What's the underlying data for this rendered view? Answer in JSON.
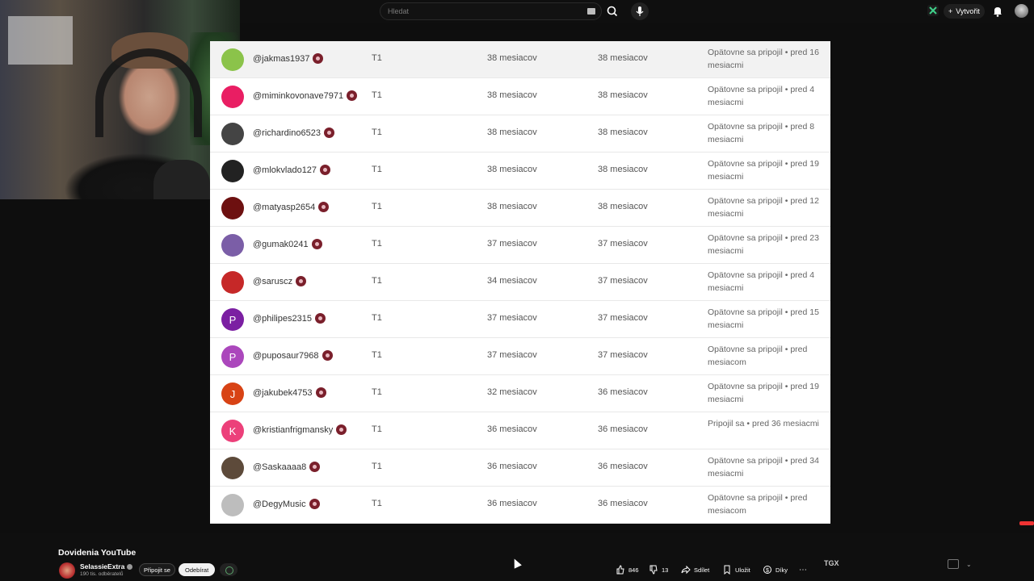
{
  "search": {
    "placeholder": "Hledat"
  },
  "header": {
    "create_label": "Vytvořit"
  },
  "rows": [
    {
      "username": "@jakmas1937",
      "tier": "T1",
      "col1": "38 mesiacov",
      "col2": "38 mesiacov",
      "status": "Opätovne sa pripojil • pred 16 mesiacmi",
      "avatar_letter": "",
      "avatar_color": "#8bc34a"
    },
    {
      "username": "@miminkovonave7971",
      "tier": "T1",
      "col1": "38 mesiacov",
      "col2": "38 mesiacov",
      "status": "Opätovne sa pripojil • pred 4 mesiacmi",
      "avatar_letter": "",
      "avatar_color": "#e91e63"
    },
    {
      "username": "@richardino6523",
      "tier": "T1",
      "col1": "38 mesiacov",
      "col2": "38 mesiacov",
      "status": "Opätovne sa pripojil • pred 8 mesiacmi",
      "avatar_letter": "",
      "avatar_color": "#444444"
    },
    {
      "username": "@mlokvlado127",
      "tier": "T1",
      "col1": "38 mesiacov",
      "col2": "38 mesiacov",
      "status": "Opätovne sa pripojil • pred 19 mesiacmi",
      "avatar_letter": "",
      "avatar_color": "#222222"
    },
    {
      "username": "@matyasp2654",
      "tier": "T1",
      "col1": "38 mesiacov",
      "col2": "38 mesiacov",
      "status": "Opätovne sa pripojil • pred 12 mesiacmi",
      "avatar_letter": "",
      "avatar_color": "#6d1010"
    },
    {
      "username": "@gumak0241",
      "tier": "T1",
      "col1": "37 mesiacov",
      "col2": "37 mesiacov",
      "status": "Opätovne sa pripojil • pred 23 mesiacmi",
      "avatar_letter": "",
      "avatar_color": "#7b5ea7"
    },
    {
      "username": "@saruscz",
      "tier": "T1",
      "col1": "34 mesiacov",
      "col2": "37 mesiacov",
      "status": "Opätovne sa pripojil • pred 4 mesiacmi",
      "avatar_letter": "",
      "avatar_color": "#c62828"
    },
    {
      "username": "@philipes2315",
      "tier": "T1",
      "col1": "37 mesiacov",
      "col2": "37 mesiacov",
      "status": "Opätovne sa pripojil • pred 15 mesiacmi",
      "avatar_letter": "P",
      "avatar_color": "#7b1fa2"
    },
    {
      "username": "@puposaur7968",
      "tier": "T1",
      "col1": "37 mesiacov",
      "col2": "37 mesiacov",
      "status": "Opätovne sa pripojil • pred mesiacom",
      "avatar_letter": "P",
      "avatar_color": "#ab47bc"
    },
    {
      "username": "@jakubek4753",
      "tier": "T1",
      "col1": "32 mesiacov",
      "col2": "36 mesiacov",
      "status": "Opätovne sa pripojil • pred 19 mesiacmi",
      "avatar_letter": "J",
      "avatar_color": "#d84315"
    },
    {
      "username": "@kristianfrigmansky",
      "tier": "T1",
      "col1": "36 mesiacov",
      "col2": "36 mesiacov",
      "status": "Pripojil sa • pred 36 mesiacmi",
      "avatar_letter": "K",
      "avatar_color": "#ec407a"
    },
    {
      "username": "@Saskaaaa8",
      "tier": "T1",
      "col1": "36 mesiacov",
      "col2": "36 mesiacov",
      "status": "Opätovne sa pripojil • pred 34 mesiacmi",
      "avatar_letter": "",
      "avatar_color": "#5d4a3a"
    },
    {
      "username": "@DegyMusic",
      "tier": "T1",
      "col1": "36 mesiacov",
      "col2": "36 mesiacov",
      "status": "Opätovne sa pripojil • pred mesiacom",
      "avatar_letter": "",
      "avatar_color": "#bdbdbd"
    }
  ],
  "video": {
    "title": "Dovidenia YouTube",
    "channel": "SelassieExtra",
    "subscribers": "190 tis. odběratelů",
    "join_label": "Připojit se",
    "subscribe_label": "Odebírat",
    "likes": "846",
    "dislikes": "13",
    "share_label": "Sdílet",
    "save_label": "Uložit",
    "thanks_label": "Díky",
    "mini_logo": "TGX"
  }
}
